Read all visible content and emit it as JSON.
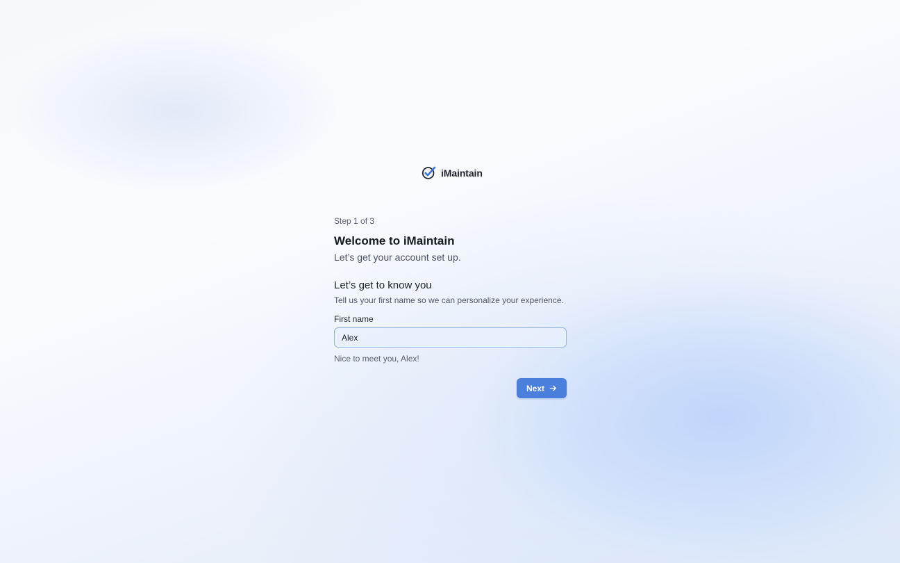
{
  "brand": {
    "name": "iMaintain",
    "icon": "check-circle-icon"
  },
  "onboarding": {
    "step_text": "Step 1 of 3",
    "title": "Welcome to iMaintain",
    "subtitle": "Let’s get your account set up.",
    "section_title": "Let’s get to know you",
    "section_description": "Tell us your first name so we can personalize your experience.",
    "first_name_label": "First name",
    "first_name_value": "Alex",
    "greeting": "Nice to meet you, Alex!",
    "next_label": "Next",
    "next_icon": "arrow-right-icon"
  },
  "colors": {
    "accent": "#4a7fdc",
    "input_border": "#93b4e4"
  }
}
